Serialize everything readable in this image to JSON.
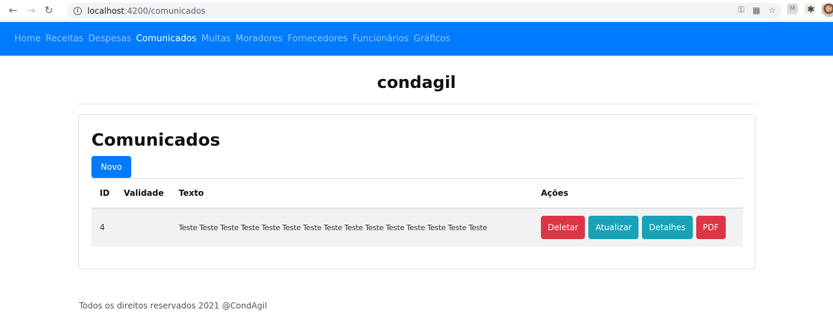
{
  "browser": {
    "url_host": "localhost",
    "url_rest": ":4200/comunicados",
    "icons": [
      "back-arrow-icon",
      "forward-arrow-icon",
      "reload-icon",
      "info-icon",
      "key-icon",
      "translate-icon",
      "star-icon",
      "extension-icon",
      "puzzle-icon",
      "avatar",
      "kebab-menu-icon"
    ],
    "ext_labels": [
      "M",
      "≡",
      "◎"
    ]
  },
  "navbar": {
    "links": [
      {
        "label": "Home",
        "active": false
      },
      {
        "label": "Receitas",
        "active": false
      },
      {
        "label": "Despesas",
        "active": false
      },
      {
        "label": "Comunicados",
        "active": true
      },
      {
        "label": "Multas",
        "active": false
      },
      {
        "label": "Moradores",
        "active": false
      },
      {
        "label": "Fornecedores",
        "active": false
      },
      {
        "label": "Funcionários",
        "active": false
      },
      {
        "label": "Gráficos",
        "active": false
      }
    ],
    "color": "#007bff"
  },
  "brand": "condagil",
  "page": {
    "title": "Comunicados",
    "new_button": "Novo"
  },
  "table": {
    "headers": [
      "ID",
      "Validade",
      "Texto",
      "Ações"
    ],
    "rows": [
      {
        "id": "4",
        "validade": "",
        "texto": "Teste Teste Teste Teste Teste Teste Teste Teste Teste Teste Teste Teste Teste Teste Teste",
        "actions": [
          "Deletar",
          "Atualizar",
          "Detalhes",
          "PDF"
        ]
      }
    ]
  },
  "colors": {
    "danger": "#dc3545",
    "info": "#17a2b8",
    "primary": "#007bff"
  },
  "footer": "Todos os direitos reservados 2021 @CondAgil"
}
